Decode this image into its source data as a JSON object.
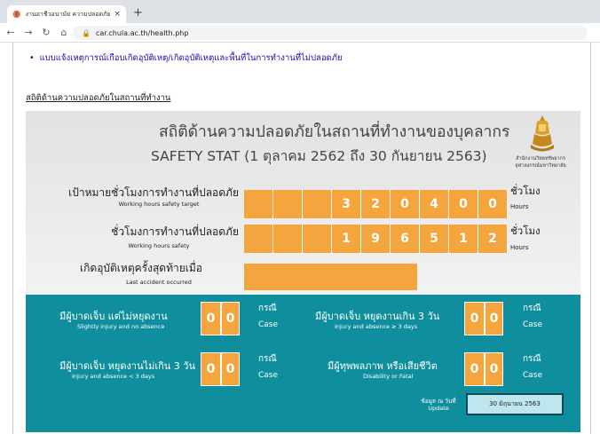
{
  "browser": {
    "tab_title": "งานอาชีวอนามัย ความปลอดภัยและสภา",
    "tab_close": "×",
    "new_tab": "+",
    "url": "car.chula.ac.th/health.php",
    "icons": [
      "back-icon",
      "forward-icon",
      "reload-icon",
      "home-icon",
      "lock-icon"
    ]
  },
  "page": {
    "bullet_link": "แบบแจ้งเหตุการณ์เกือบเกิดอุบัติเหตุ/เกิดอุบัติเหตุและพื้นที่ในการทำงานที่ไม่ปลอดภัย",
    "section_heading": "สถิติด้านความปลอดภัยในสถานที่ทำงาน"
  },
  "board": {
    "title_th": "สถิติด้านความปลอดภัยในสถานที่ทำงานของบุคลากร",
    "title_en": "SAFETY STAT (1 ตุลาคม 2562 ถึง 30 กันยายน 2563)",
    "logo_text_line1": "สำนักงานวิทยทรัพยากร",
    "logo_text_line2": "จุฬาลงกรณ์มหาวิทยาลัย",
    "target_label_th": "เป้าหมายชั่วโมงการทำงานที่ปลอดภัย",
    "target_label_en": "Working hours safety target",
    "target_digits": [
      "",
      "",
      "",
      "3",
      "2",
      "0",
      "4",
      "0",
      "0"
    ],
    "safe_label_th": "ชั่วโมงการทำงานที่ปลอดภัย",
    "safe_label_en": "Working hours safety",
    "safe_digits": [
      "",
      "",
      "",
      "1",
      "9",
      "6",
      "5",
      "1",
      "2"
    ],
    "unit_th": "ชั่วโมง",
    "unit_en": "Hours",
    "last_accident_th": "เกิดอุบัติเหตุครั้งสุดท้ายเมื่อ",
    "last_accident_en": "Last accident occurred",
    "last_accident_value": "",
    "stats": [
      {
        "th": "มีผู้บาดเจ็บ แต่ไม่หยุดงาน",
        "en": "Slightly injury and no absence",
        "digits": [
          "0",
          "0"
        ]
      },
      {
        "th": "มีผู้บาดเจ็บ หยุดงานเกิน 3 วัน",
        "en": "Injury and absence ≥ 3 days",
        "digits": [
          "0",
          "0"
        ]
      },
      {
        "th": "มีผู้บาดเจ็บ หยุดงานไม่เกิน 3 วัน",
        "en": "Injury and absence < 3 days",
        "digits": [
          "0",
          "0"
        ]
      },
      {
        "th": "มีผู้ทุพพลภาพ หรือเสียชีวิต",
        "en": "Disability or Fatal",
        "digits": [
          "0",
          "0"
        ]
      }
    ],
    "case_th": "กรณี",
    "case_en": "Case",
    "update_th": "ข้อมูล ณ วันที่",
    "update_en": "Update",
    "update_date": "30 มิถุนายน 2563"
  },
  "colors": {
    "orange": "#f4a53d",
    "teal": "#0f8f9d",
    "update_box": "#bde6ee"
  }
}
